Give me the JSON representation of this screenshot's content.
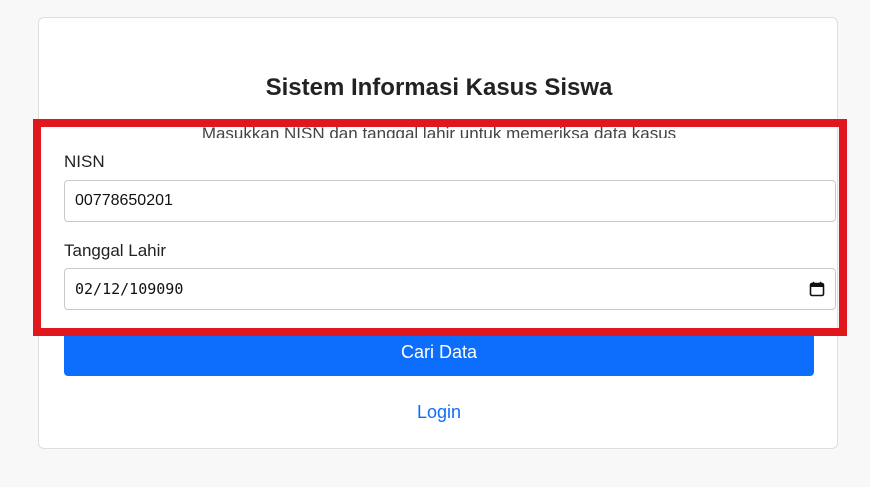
{
  "form": {
    "title": "Sistem Informasi Kasus Siswa",
    "subtitle": "Masukkan NISN dan tanggal lahir untuk memeriksa data kasus",
    "nisn_label": "NISN",
    "nisn_value": "00778650201",
    "dob_label": "Tanggal Lahir",
    "dob_value": "02/12/109090",
    "submit_label": "Cari Data",
    "login_label": "Login"
  },
  "icons": {
    "date_picker": "calendar-icon"
  },
  "colors": {
    "primary": "#0d6efd",
    "highlight": "#e0181e",
    "page_background": "#f8f8f8"
  }
}
